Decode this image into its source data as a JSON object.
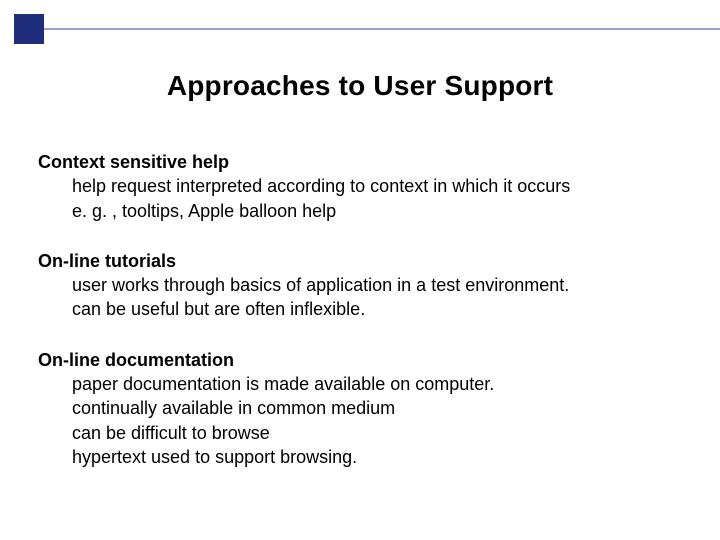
{
  "title": "Approaches to User Support",
  "sections": [
    {
      "heading": "Context sensitive help",
      "lines": [
        "help request interpreted according to context in which it occurs",
        "e. g. , tooltips, Apple balloon help"
      ]
    },
    {
      "heading": "On-line tutorials",
      "lines": [
        "user works through basics of application in a test environment.",
        "can be useful but are often inflexible."
      ]
    },
    {
      "heading": "On-line documentation",
      "lines": [
        "paper documentation is made available on computer.",
        "continually available in common medium",
        "can be difficult to browse",
        "hypertext used to support browsing."
      ]
    }
  ]
}
